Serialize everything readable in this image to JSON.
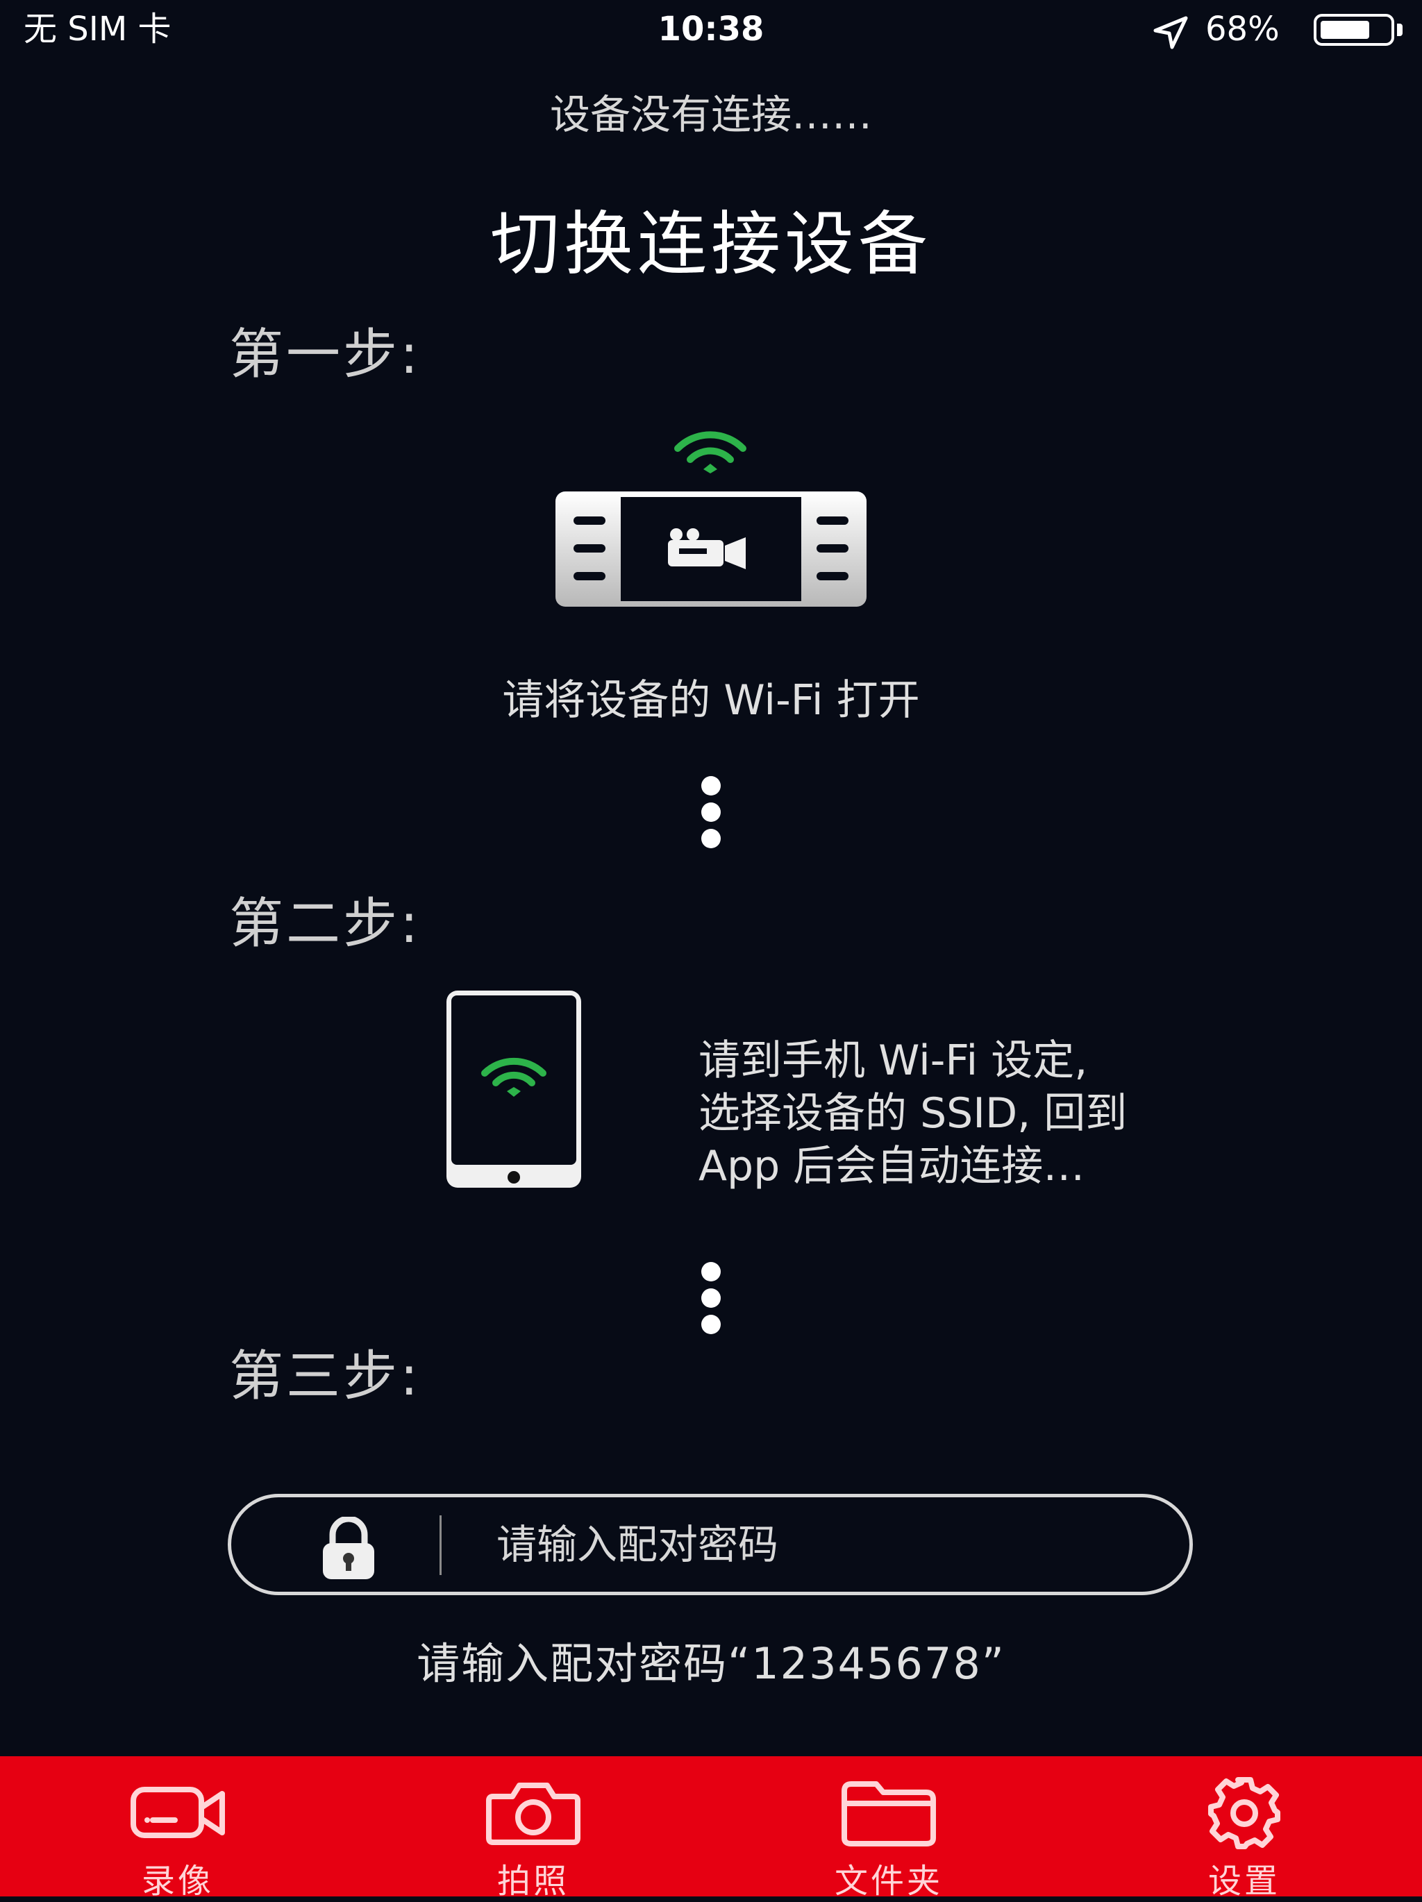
{
  "status_bar": {
    "carrier": "无 SIM 卡",
    "time": "10:38",
    "battery": "68%"
  },
  "header": {
    "status": "设备没有连接……",
    "title": "切换连接设备"
  },
  "steps": [
    {
      "label": "第一步:",
      "text": "请将设备的 Wi-Fi 打开"
    },
    {
      "label": "第二步:",
      "lines": [
        "请到手机 Wi-Fi 设定,",
        "选择设备的 SSID, 回到",
        "App 后会自动连接…"
      ]
    },
    {
      "label": "第三步:"
    }
  ],
  "password": {
    "placeholder": "请输入配对密码",
    "hint": "请输入配对密码“12345678”"
  },
  "tabs": [
    {
      "label": "录像",
      "icon": "video-camera-icon"
    },
    {
      "label": "拍照",
      "icon": "camera-icon"
    },
    {
      "label": "文件夹",
      "icon": "folder-icon"
    },
    {
      "label": "设置",
      "icon": "gear-icon"
    }
  ],
  "colors": {
    "background": "#070b16",
    "tabbar": "#e60012",
    "wifi_green": "#2db34a"
  }
}
